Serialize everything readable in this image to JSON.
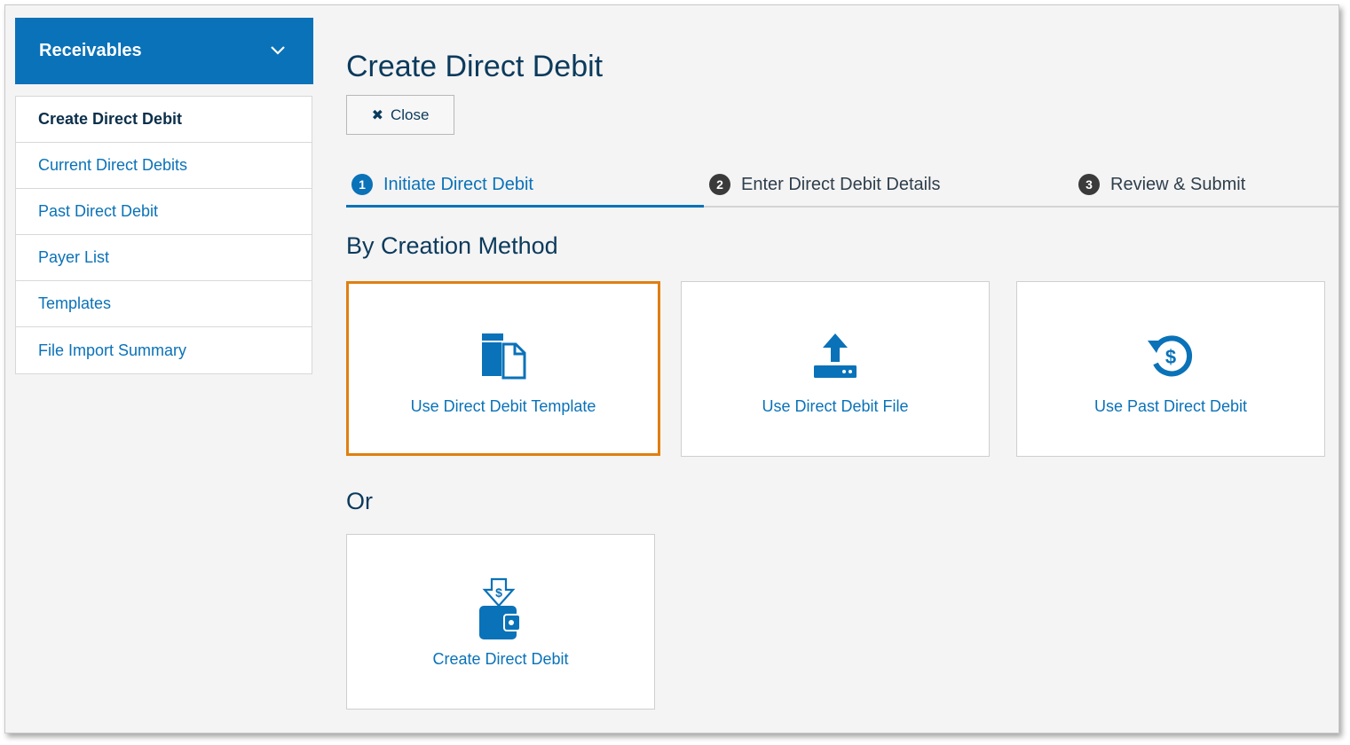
{
  "sidebar": {
    "header": "Receivables",
    "items": [
      {
        "label": "Create Direct Debit",
        "active": true
      },
      {
        "label": "Current Direct Debits"
      },
      {
        "label": "Past Direct Debit"
      },
      {
        "label": "Payer List"
      },
      {
        "label": "Templates"
      },
      {
        "label": "File Import Summary"
      }
    ]
  },
  "main": {
    "title": "Create Direct Debit",
    "close_label": "Close",
    "steps": [
      {
        "num": "1",
        "label": "Initiate Direct Debit",
        "active": true
      },
      {
        "num": "2",
        "label": "Enter Direct Debit Details"
      },
      {
        "num": "3",
        "label": "Review & Submit"
      }
    ],
    "by_method_title": "By Creation Method",
    "or_title": "Or",
    "cards": [
      {
        "label": "Use Direct Debit Template",
        "icon": "template-icon",
        "selected": true
      },
      {
        "label": "Use Direct Debit File",
        "icon": "upload-icon"
      },
      {
        "label": "Use Past Direct Debit",
        "icon": "history-dollar-icon"
      },
      {
        "label": "Create Direct Debit",
        "icon": "wallet-download-icon"
      }
    ]
  },
  "colors": {
    "primary": "#0a72b8",
    "highlight": "#e07f10",
    "background": "#f4f4f4"
  }
}
